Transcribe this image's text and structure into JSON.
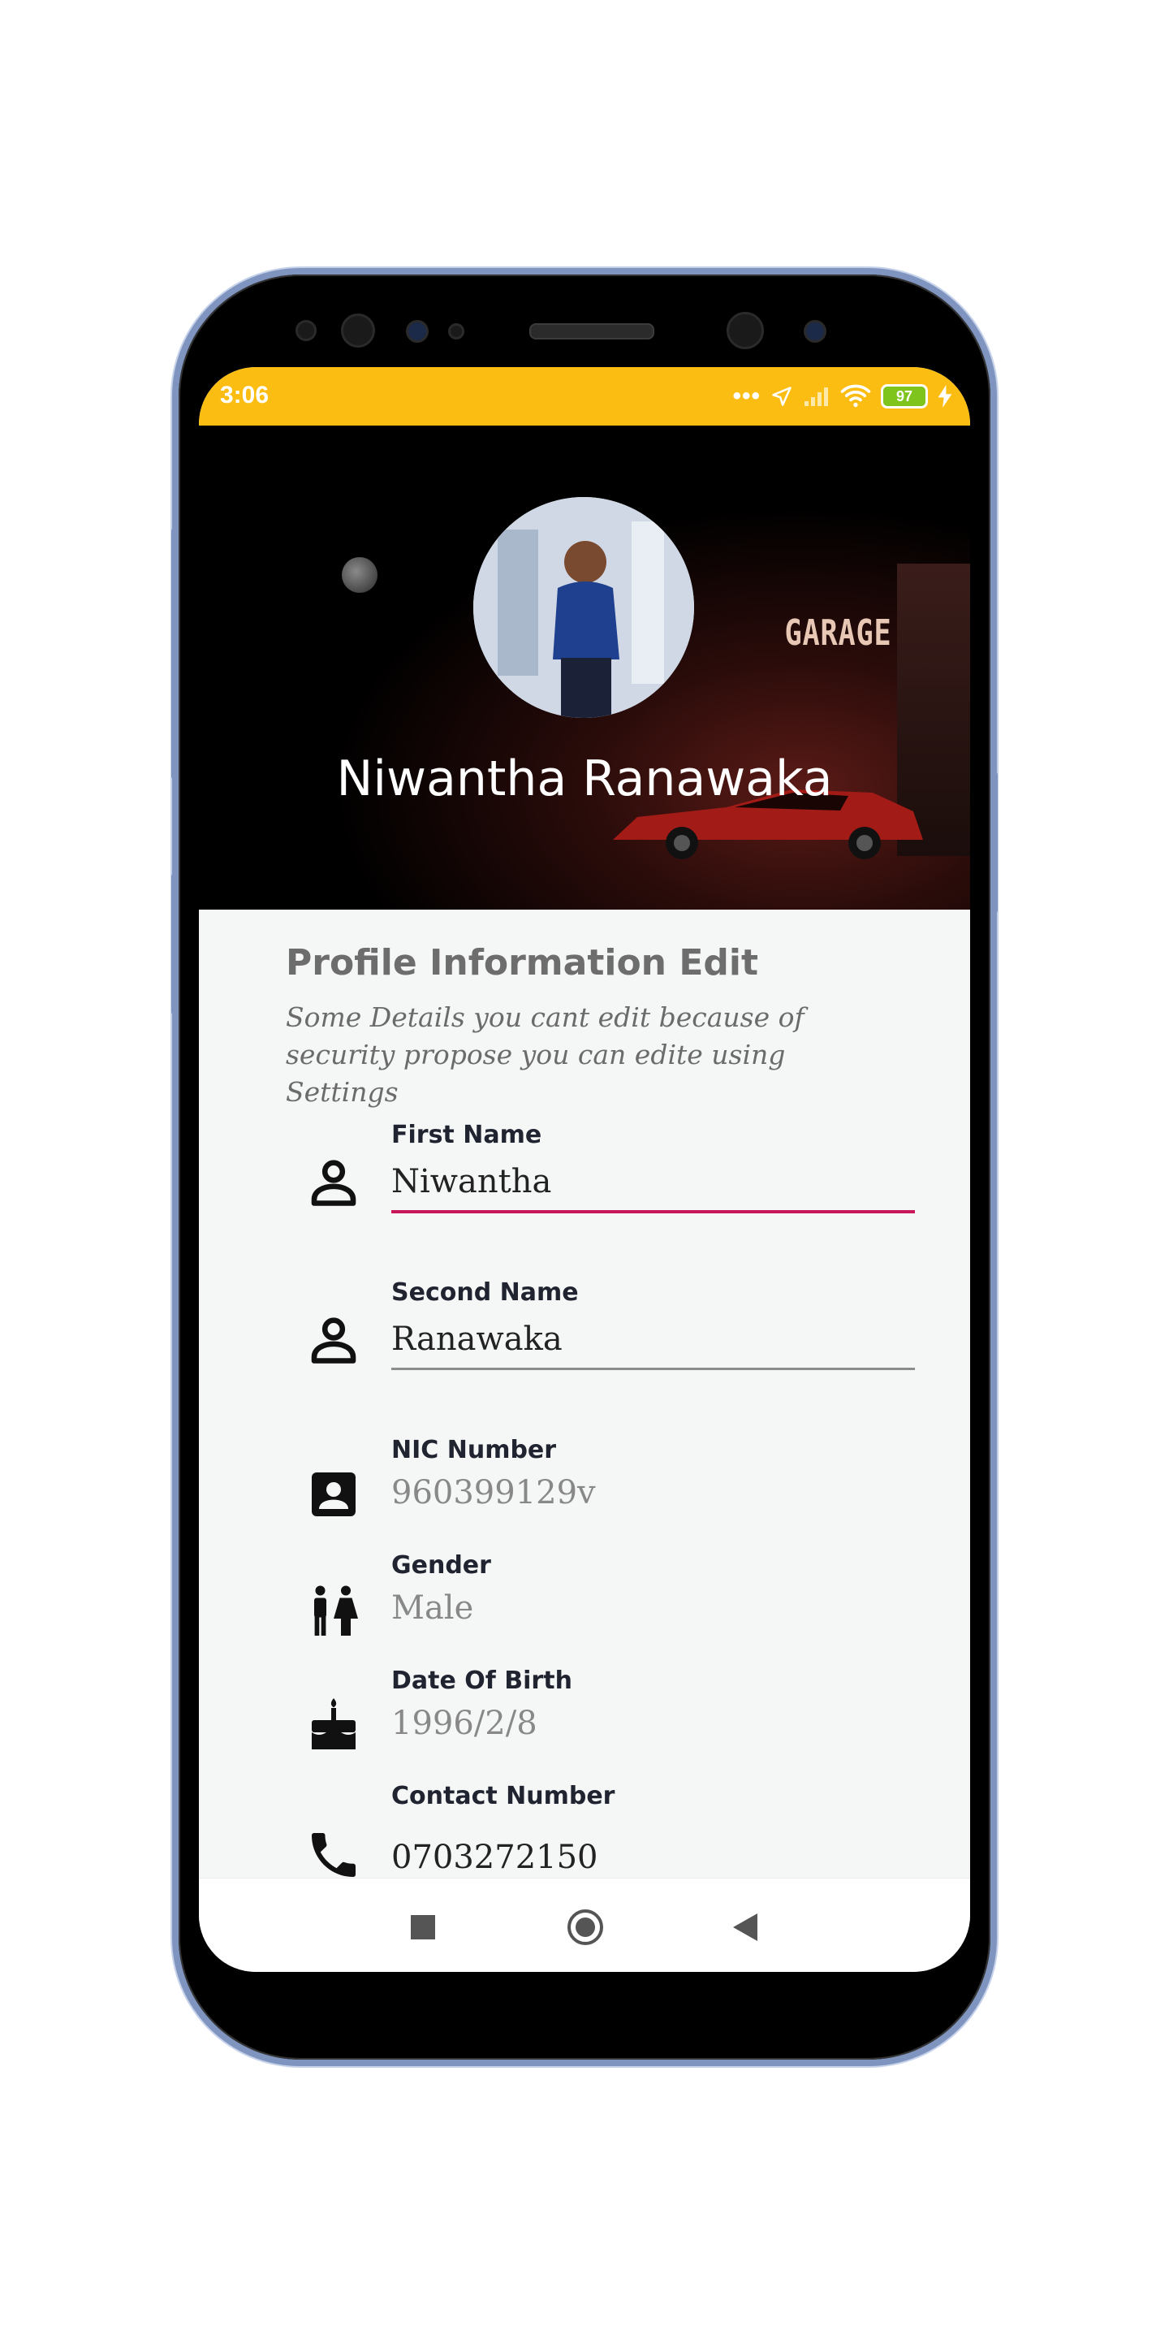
{
  "status_bar": {
    "time": "3:06",
    "battery": "97",
    "icons": [
      "more-dots-icon",
      "location-arrow-icon",
      "signal-icon",
      "wifi-icon",
      "battery-icon",
      "charging-bolt-icon"
    ]
  },
  "profile": {
    "name": "Niwantha Ranawaka",
    "header_sign": "GARAGE"
  },
  "section": {
    "title": "Profile Information Edit",
    "subtitle": "Some Details you cant edit because of security propose you can edite using Settings"
  },
  "fields": {
    "first_name": {
      "label": "First Name",
      "value": "Niwantha",
      "icon": "person-outline-icon"
    },
    "second_name": {
      "label": "Second Name",
      "value": "Ranawaka",
      "icon": "person-outline-icon"
    },
    "nic": {
      "label": "NIC Number",
      "value": "960399129v",
      "icon": "contact-card-icon"
    },
    "gender": {
      "label": "Gender",
      "value": "Male",
      "icon": "wc-icon"
    },
    "dob": {
      "label": "Date Of Birth",
      "value": "1996/2/8",
      "icon": "cake-icon"
    },
    "contact": {
      "label": "Contact Number",
      "value": "0703272150",
      "icon": "phone-icon"
    }
  },
  "colors": {
    "status_bar": "#fcbd12",
    "active_underline": "#c8185a",
    "content_bg": "#f5f6f6"
  },
  "navigation": [
    "recents-square-icon",
    "home-circle-icon",
    "back-triangle-icon"
  ]
}
